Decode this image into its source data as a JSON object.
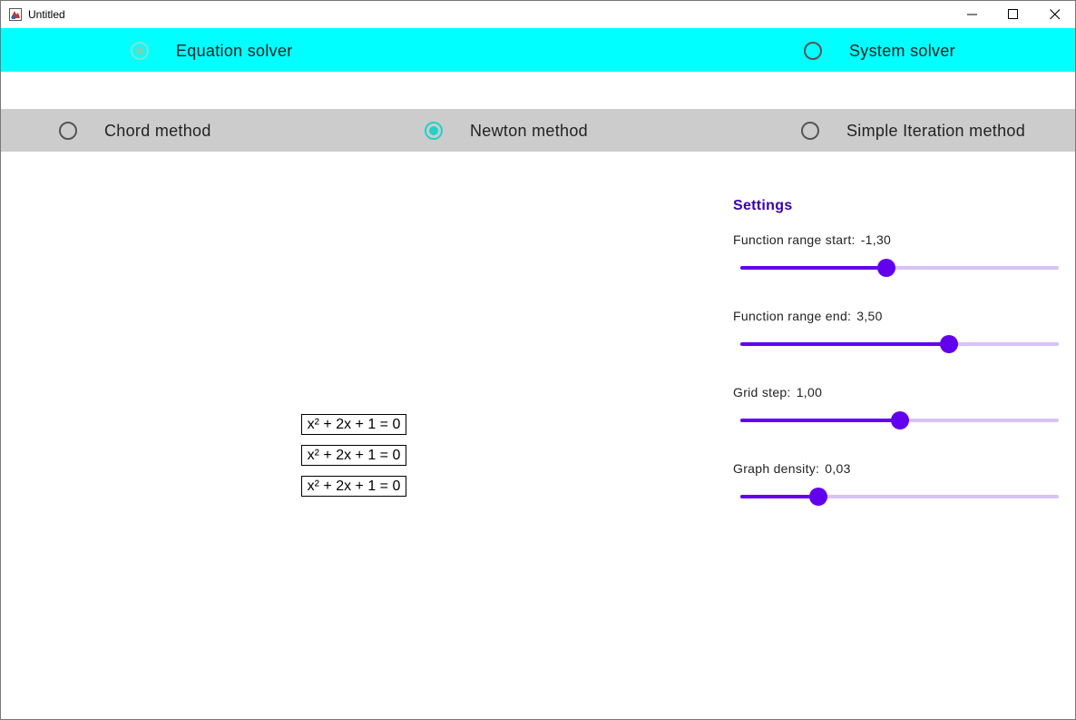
{
  "window": {
    "title": "Untitled"
  },
  "modes": [
    {
      "label": "Equation solver",
      "selected": true
    },
    {
      "label": "System solver",
      "selected": false
    }
  ],
  "methods": [
    {
      "label": "Chord method",
      "selected": false
    },
    {
      "label": "Newton method",
      "selected": true
    },
    {
      "label": "Simple Iteration method",
      "selected": false
    }
  ],
  "equations": [
    "x² + 2x + 1 = 0",
    "x² + 2x + 1 = 0",
    "x² + 2x + 1 = 0"
  ],
  "settings": {
    "title": "Settings",
    "sliders": [
      {
        "label": "Function range start:",
        "value": "-1,30",
        "fraction": 0.458
      },
      {
        "label": "Function range end:",
        "value": "3,50",
        "fraction": 0.656
      },
      {
        "label": "Grid step:",
        "value": "1,00",
        "fraction": 0.501
      },
      {
        "label": "Graph density:",
        "value": "0,03",
        "fraction": 0.245
      }
    ]
  },
  "colors": {
    "mode_bar": "#00ffff",
    "method_bar": "#cccccc",
    "accent": "#6200ee",
    "radio_selected": "#1fd3c6",
    "settings_title": "#3a00a8"
  },
  "icons": [
    "app-icon",
    "minimize-icon",
    "maximize-icon",
    "close-icon"
  ]
}
